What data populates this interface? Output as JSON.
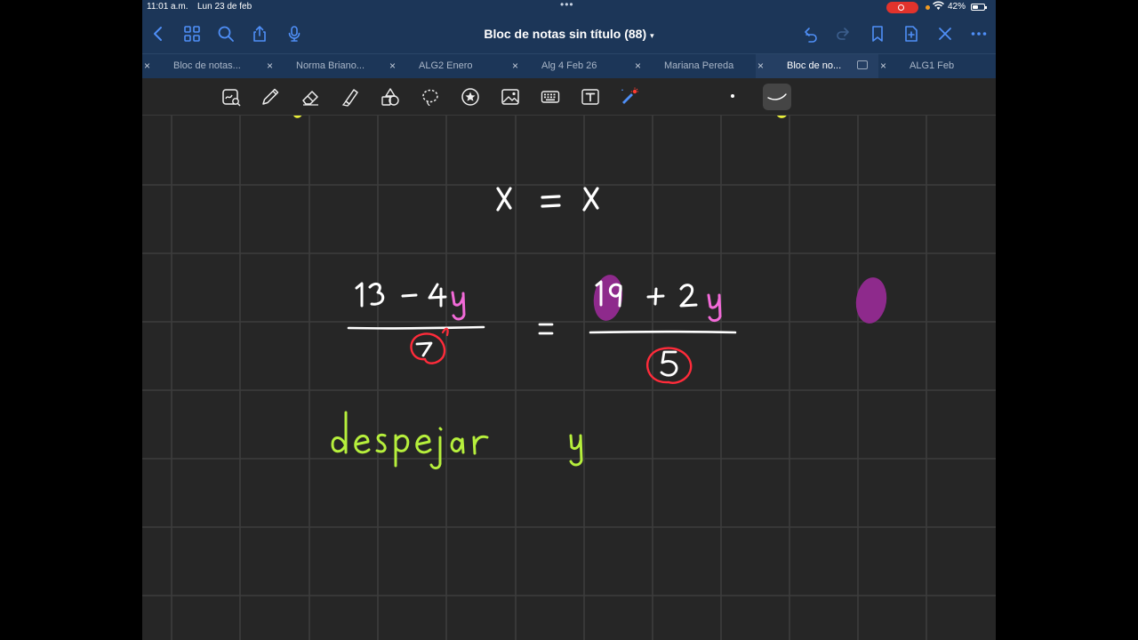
{
  "status": {
    "time": "11:01 a.m.",
    "date": "Lun 23 de feb",
    "battery": "42%"
  },
  "header": {
    "title": "Bloc de notas sin título (88)"
  },
  "tabs": [
    {
      "label": "Bloc de notas...",
      "close": "×"
    },
    {
      "label": "Norma Briano...",
      "close": "×"
    },
    {
      "label": "ALG2 Enero",
      "close": "×"
    },
    {
      "label": "Alg 4 Feb 26",
      "close": "×"
    },
    {
      "label": "Mariana Pereda",
      "close": "×"
    },
    {
      "label": "Bloc de no...",
      "close": "×",
      "active": true
    },
    {
      "label": "ALG1 Feb",
      "close": "×"
    }
  ],
  "colors": {
    "nav_bg": "#1c3658",
    "canvas_bg": "#262626",
    "grid_line": "#3d3d3d",
    "ink_white": "#ffffff",
    "ink_green": "#b6ef3c",
    "ink_red": "#ff2b3a",
    "highlight_purple": "#8e2a8c",
    "ink_pink": "#f26ad8"
  },
  "icons": {
    "nav_left": [
      "back-icon",
      "grid-icon",
      "search-icon",
      "share-icon",
      "microphone-icon"
    ],
    "nav_right": [
      "undo-icon",
      "redo-icon",
      "bookmark-icon",
      "add-page-icon",
      "close-icon",
      "more-icon"
    ],
    "tools": [
      "smart-ink-icon",
      "pen-icon",
      "eraser-icon",
      "highlighter-icon",
      "shapes-icon",
      "lasso-icon",
      "sticker-icon",
      "image-icon",
      "keyboard-icon",
      "text-box-icon",
      "laser-pointer-icon"
    ]
  }
}
